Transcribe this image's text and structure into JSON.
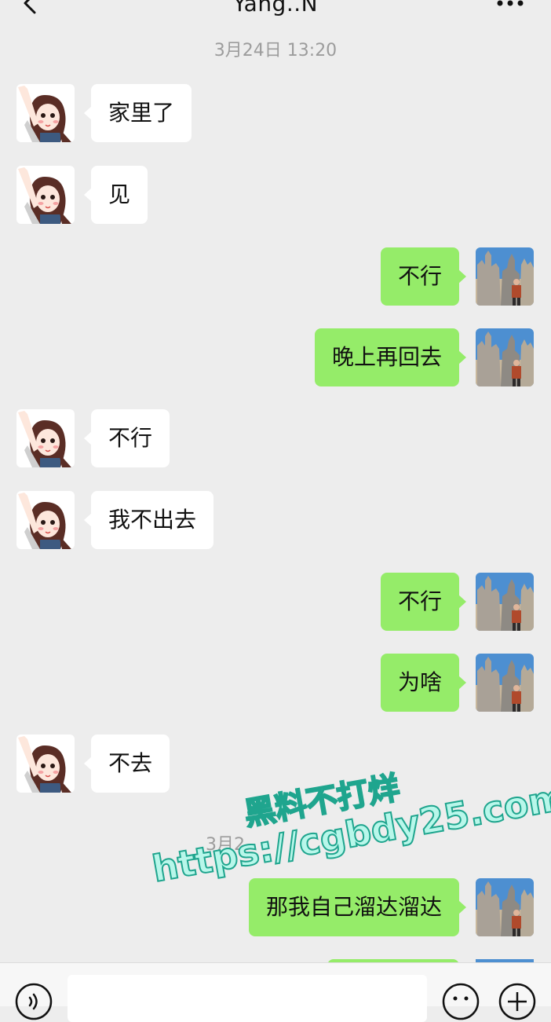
{
  "header": {
    "title": "Yang..N"
  },
  "timestamps": [
    "3月24日 13:20",
    "3月2"
  ],
  "messages": [
    {
      "side": "left",
      "text": "家里了"
    },
    {
      "side": "left",
      "text": "见"
    },
    {
      "side": "right",
      "text": "不行"
    },
    {
      "side": "right",
      "text": "晚上再回去"
    },
    {
      "side": "left",
      "text": "不行"
    },
    {
      "side": "left",
      "text": "我不出去"
    },
    {
      "side": "right",
      "text": "不行"
    },
    {
      "side": "right",
      "text": "为啥"
    },
    {
      "side": "left",
      "text": "不去"
    },
    {
      "side": "right",
      "text": "那我自己溜达溜达"
    }
  ],
  "watermark": {
    "line1": "黑料不打烊",
    "line2": "https://cgbdy25.com"
  },
  "colors": {
    "background": "#ededed",
    "sent_bubble": "#95ec69",
    "received_bubble": "#ffffff"
  },
  "icons": {
    "back": "back-arrow-icon",
    "more": "more-dots-icon",
    "voice": "voice-icon",
    "emoji": "emoji-icon",
    "plus": "plus-icon"
  }
}
